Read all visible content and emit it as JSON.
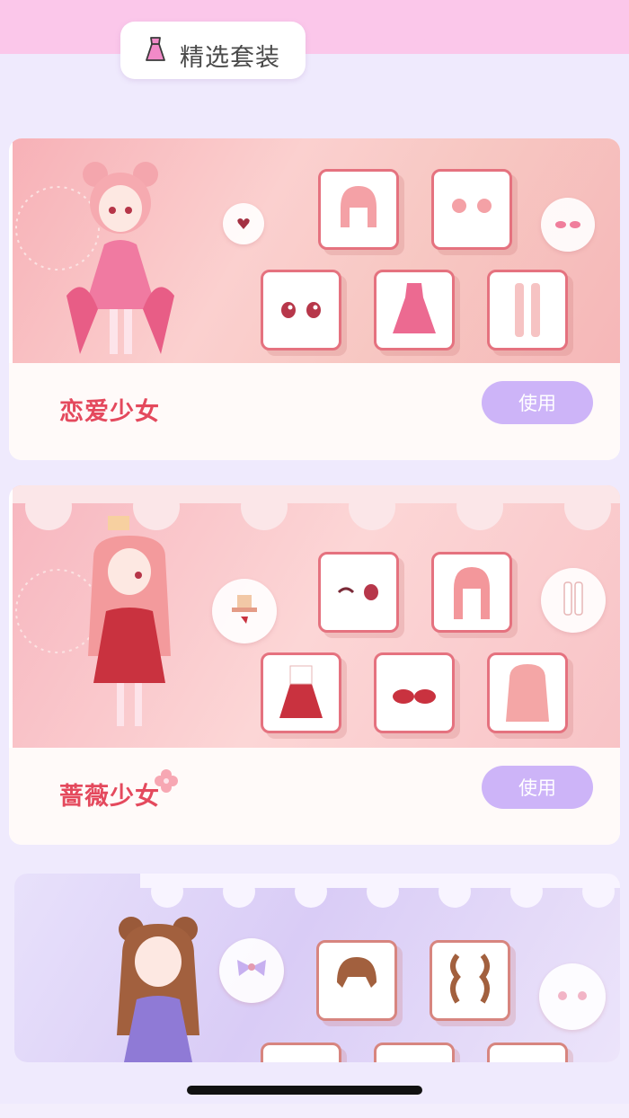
{
  "header": {
    "title": "精选套装",
    "icon": "dress-icon",
    "accent": "#fbc7ea"
  },
  "suits": [
    {
      "name": "恋爱少女",
      "button_label": "使用",
      "items": [
        "hair-icon",
        "ear-ornament-icon",
        "eyes-icon",
        "outfit-icon",
        "stockings-icon"
      ],
      "side_items": [
        "heart-accessory-icon",
        "blush-icon"
      ]
    },
    {
      "name": "蔷薇少女",
      "button_label": "使用",
      "items": [
        "face-icon",
        "hair-icon",
        "dress-icon",
        "shoes-icon",
        "long-hair-icon"
      ],
      "side_items": [
        "hat-icon",
        "socks-icon"
      ]
    },
    {
      "name": "",
      "button_label": "",
      "items": [
        "hair-icon",
        "braid-icon"
      ],
      "side_items": [
        "bow-icon",
        "flower-hairpin-icon"
      ]
    }
  ],
  "colors": {
    "button": "#cdb4f8",
    "suit_name": "#e4495d",
    "item_border": "#e5727f"
  }
}
